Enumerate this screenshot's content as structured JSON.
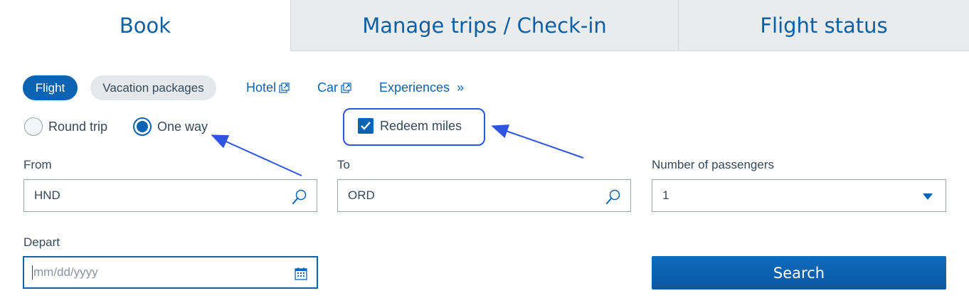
{
  "tabs": [
    {
      "label": "Book"
    },
    {
      "label": "Manage trips / Check-in"
    },
    {
      "label": "Flight status"
    }
  ],
  "products": {
    "flight": "Flight",
    "vacation": "Vacation packages",
    "hotel": "Hotel",
    "car": "Car",
    "experiences": "Experiences",
    "experiences_suffix": "»"
  },
  "trip_type": {
    "round_trip": "Round trip",
    "one_way": "One way",
    "selected": "One way"
  },
  "redeem": {
    "label": "Redeem miles",
    "checked": true
  },
  "form": {
    "from_label": "From",
    "from_value": "HND",
    "to_label": "To",
    "to_value": "ORD",
    "passengers_label": "Number of passengers",
    "passengers_value": "1",
    "depart_label": "Depart",
    "depart_placeholder": "mm/dd/yyyy",
    "search_label": "Search"
  },
  "icons": {
    "external_link": "external-link-icon",
    "search": "magnifier-icon",
    "calendar": "calendar-icon",
    "dropdown": "chevron-down-icon"
  },
  "colors": {
    "brand_blue": "#0b63b4",
    "tab_inactive_bg": "#e9eced",
    "annotation_blue": "#2d55e0"
  }
}
